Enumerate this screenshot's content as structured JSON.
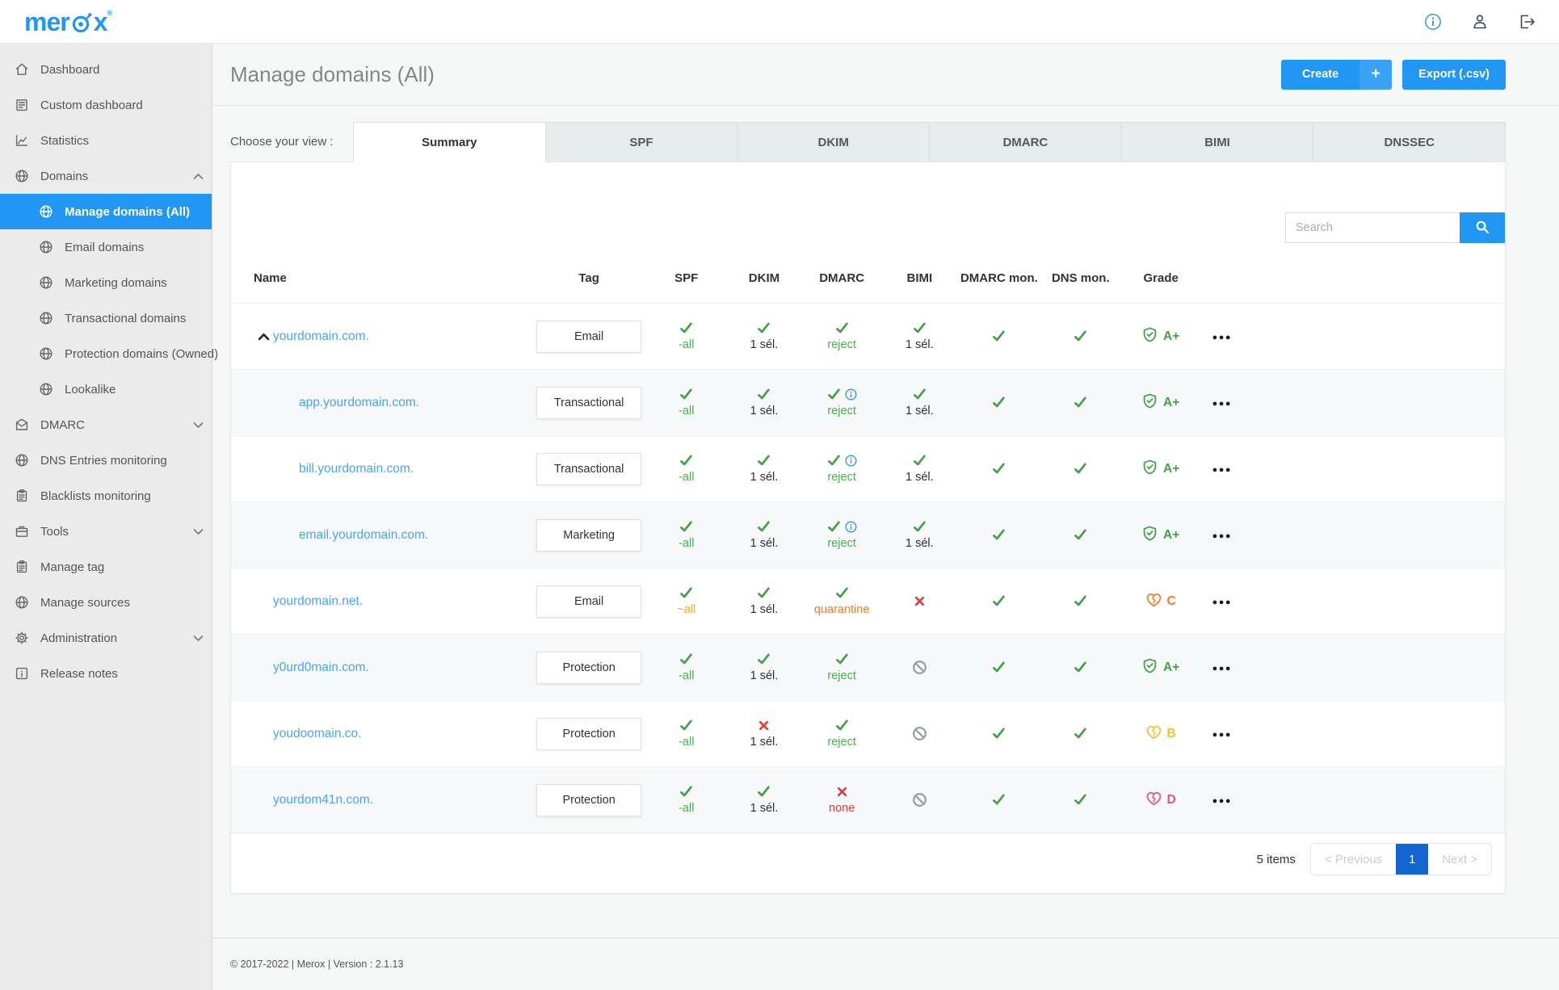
{
  "topbar": {
    "logo_pre": "mer",
    "logo_post": "x",
    "logo_reg": "®"
  },
  "header": {
    "title": "Manage domains (All)",
    "create_label": "Create",
    "create_plus": "+",
    "export_label": "Export (.csv)"
  },
  "view_bar": {
    "label": "Choose your view :",
    "tabs": [
      {
        "label": "Summary",
        "active": true
      },
      {
        "label": "SPF",
        "active": false
      },
      {
        "label": "DKIM",
        "active": false
      },
      {
        "label": "DMARC",
        "active": false
      },
      {
        "label": "BIMI",
        "active": false
      },
      {
        "label": "DNSSEC",
        "active": false
      }
    ]
  },
  "search": {
    "placeholder": "Search"
  },
  "sidebar": {
    "items": [
      {
        "label": "Dashboard",
        "icon": "home"
      },
      {
        "label": "Custom dashboard",
        "icon": "doc"
      },
      {
        "label": "Statistics",
        "icon": "stats"
      },
      {
        "label": "Domains",
        "icon": "globe",
        "chevron": "up"
      },
      {
        "label": "Manage domains (All)",
        "icon": "globe",
        "child": true,
        "active": true
      },
      {
        "label": "Email domains",
        "icon": "globe",
        "child": true
      },
      {
        "label": "Marketing domains",
        "icon": "globe",
        "child": true
      },
      {
        "label": "Transactional domains",
        "icon": "globe",
        "child": true
      },
      {
        "label": "Protection domains (Owned)",
        "icon": "globe",
        "child": true
      },
      {
        "label": "Lookalike",
        "icon": "globe",
        "child": true
      },
      {
        "label": "DMARC",
        "icon": "mail",
        "chevron": "down"
      },
      {
        "label": "DNS Entries monitoring",
        "icon": "globe"
      },
      {
        "label": "Blacklists monitoring",
        "icon": "clipboard"
      },
      {
        "label": "Tools",
        "icon": "tools",
        "chevron": "down"
      },
      {
        "label": "Manage tag",
        "icon": "clipboard"
      },
      {
        "label": "Manage sources",
        "icon": "globe"
      },
      {
        "label": "Administration",
        "icon": "gear",
        "chevron": "down"
      },
      {
        "label": "Release notes",
        "icon": "infosq"
      }
    ]
  },
  "table": {
    "columns": [
      "Name",
      "Tag",
      "SPF",
      "DKIM",
      "DMARC",
      "BIMI",
      "DMARC mon.",
      "DNS mon.",
      "Grade"
    ],
    "rows": [
      {
        "name": "yourdomain.com.",
        "caret": true,
        "tag": "Email",
        "spf": {
          "icon": "check",
          "text": "-all",
          "color": "green"
        },
        "dkim": {
          "icon": "check",
          "text": "1 sél.",
          "color": "dark"
        },
        "dmarc": {
          "icon": "check",
          "text": "reject",
          "color": "green"
        },
        "bimi": {
          "icon": "check",
          "text": "1 sél.",
          "color": "dark"
        },
        "dmarc_mon": {
          "icon": "check"
        },
        "dns_mon": {
          "icon": "check"
        },
        "grade": {
          "letter": "A+",
          "icon": "shield",
          "color": "green"
        }
      },
      {
        "name": "app.yourdomain.com.",
        "child": true,
        "tag": "Transactional",
        "spf": {
          "icon": "check",
          "text": "-all",
          "color": "green"
        },
        "dkim": {
          "icon": "check",
          "text": "1 sél.",
          "color": "dark"
        },
        "dmarc": {
          "icon": "check",
          "info": true,
          "text": "reject",
          "color": "green"
        },
        "bimi": {
          "icon": "check",
          "text": "1 sél.",
          "color": "dark"
        },
        "dmarc_mon": {
          "icon": "check"
        },
        "dns_mon": {
          "icon": "check"
        },
        "grade": {
          "letter": "A+",
          "icon": "shield",
          "color": "green"
        }
      },
      {
        "name": "bill.yourdomain.com.",
        "child": true,
        "tag": "Transactional",
        "spf": {
          "icon": "check",
          "text": "-all",
          "color": "green"
        },
        "dkim": {
          "icon": "check",
          "text": "1 sél.",
          "color": "dark"
        },
        "dmarc": {
          "icon": "check",
          "info": true,
          "text": "reject",
          "color": "green"
        },
        "bimi": {
          "icon": "check",
          "text": "1 sél.",
          "color": "dark"
        },
        "dmarc_mon": {
          "icon": "check"
        },
        "dns_mon": {
          "icon": "check"
        },
        "grade": {
          "letter": "A+",
          "icon": "shield",
          "color": "green"
        }
      },
      {
        "name": "email.yourdomain.com.",
        "child": true,
        "tag": "Marketing",
        "spf": {
          "icon": "check",
          "text": "-all",
          "color": "green"
        },
        "dkim": {
          "icon": "check",
          "text": "1 sél.",
          "color": "dark"
        },
        "dmarc": {
          "icon": "check",
          "info": true,
          "text": "reject",
          "color": "green"
        },
        "bimi": {
          "icon": "check",
          "text": "1 sél.",
          "color": "dark"
        },
        "dmarc_mon": {
          "icon": "check"
        },
        "dns_mon": {
          "icon": "check"
        },
        "grade": {
          "letter": "A+",
          "icon": "shield",
          "color": "green"
        }
      },
      {
        "name": "yourdomain.net.",
        "tag": "Email",
        "spf": {
          "icon": "check",
          "text": "~all",
          "color": "gold"
        },
        "dkim": {
          "icon": "check",
          "text": "1 sél.",
          "color": "dark"
        },
        "dmarc": {
          "icon": "check",
          "text": "quarantine",
          "color": "orange"
        },
        "bimi": {
          "icon": "x"
        },
        "dmarc_mon": {
          "icon": "check"
        },
        "dns_mon": {
          "icon": "check"
        },
        "grade": {
          "letter": "C",
          "icon": "heart",
          "color": "orange"
        }
      },
      {
        "name": "y0urd0main.com.",
        "tag": "Protection",
        "spf": {
          "icon": "check",
          "text": "-all",
          "color": "green"
        },
        "dkim": {
          "icon": "check",
          "text": "1 sél.",
          "color": "dark"
        },
        "dmarc": {
          "icon": "check",
          "text": "reject",
          "color": "green"
        },
        "bimi": {
          "icon": "ban"
        },
        "dmarc_mon": {
          "icon": "check"
        },
        "dns_mon": {
          "icon": "check"
        },
        "grade": {
          "letter": "A+",
          "icon": "shield",
          "color": "green"
        }
      },
      {
        "name": "youdoomain.co.",
        "tag": "Protection",
        "spf": {
          "icon": "check",
          "text": "-all",
          "color": "green"
        },
        "dkim": {
          "icon": "x",
          "text": "1 sél.",
          "color": "dark"
        },
        "dmarc": {
          "icon": "check",
          "text": "reject",
          "color": "green"
        },
        "bimi": {
          "icon": "ban"
        },
        "dmarc_mon": {
          "icon": "check"
        },
        "dns_mon": {
          "icon": "check"
        },
        "grade": {
          "letter": "B",
          "icon": "heart",
          "color": "yellow"
        }
      },
      {
        "name": "yourdom41n.com.",
        "tag": "Protection",
        "spf": {
          "icon": "check",
          "text": "-all",
          "color": "green"
        },
        "dkim": {
          "icon": "check",
          "text": "1 sél.",
          "color": "dark"
        },
        "dmarc": {
          "icon": "x",
          "text": "none",
          "color": "red"
        },
        "bimi": {
          "icon": "ban"
        },
        "dmarc_mon": {
          "icon": "check"
        },
        "dns_mon": {
          "icon": "check"
        },
        "grade": {
          "letter": "D",
          "icon": "heart",
          "color": "red"
        }
      }
    ]
  },
  "pagination": {
    "items": "5 items",
    "prev": "< Previous",
    "page": "1",
    "next": "Next >"
  },
  "footer": {
    "text": "© 2017-2022 | Merox | Version : 2.1.13"
  },
  "colors": {
    "accent": "#2196f3",
    "link": "#4aa4f6",
    "green": "#43a047",
    "green_text": "#4caf50",
    "gold": "#f0ad2e",
    "orange": "#ed7d31",
    "red": "#e53935",
    "pink": "#e8566d",
    "yellow": "#f2c230",
    "gray": "#9aa0a6",
    "info": "#2d9cdb",
    "page_active": "#1266d1"
  }
}
